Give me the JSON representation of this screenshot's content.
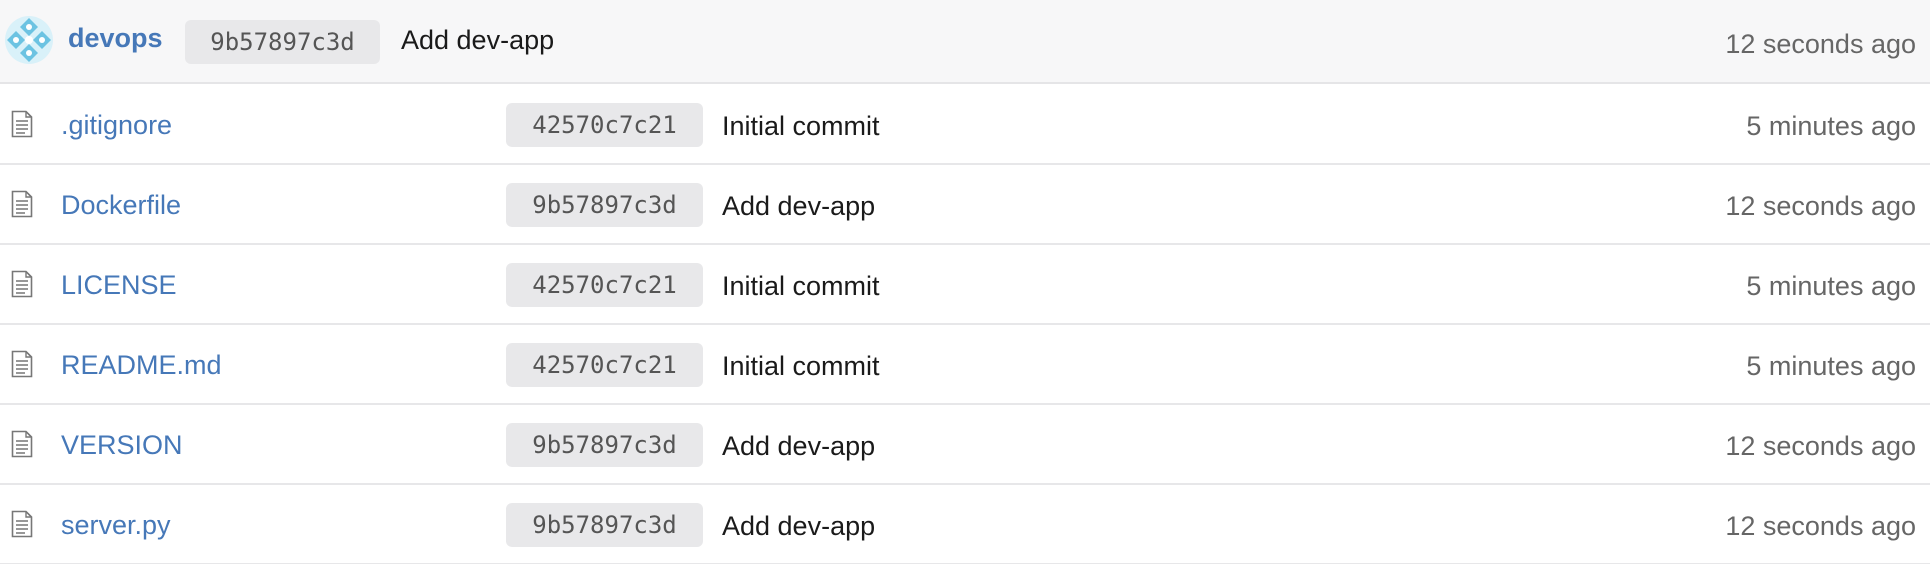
{
  "latest_commit": {
    "author": "devops",
    "sha": "9b57897c3d",
    "message": "Add dev-app",
    "time": "12 seconds ago",
    "avatar_color": "#6cc3e2"
  },
  "files": [
    {
      "icon": "file-icon",
      "name": ".gitignore",
      "sha": "42570c7c21",
      "message": "Initial commit",
      "time": "5 minutes ago"
    },
    {
      "icon": "file-icon",
      "name": "Dockerfile",
      "sha": "9b57897c3d",
      "message": "Add dev-app",
      "time": "12 seconds ago"
    },
    {
      "icon": "file-icon",
      "name": "LICENSE",
      "sha": "42570c7c21",
      "message": "Initial commit",
      "time": "5 minutes ago"
    },
    {
      "icon": "file-icon",
      "name": "README.md",
      "sha": "42570c7c21",
      "message": "Initial commit",
      "time": "5 minutes ago"
    },
    {
      "icon": "file-icon",
      "name": "VERSION",
      "sha": "9b57897c3d",
      "message": "Add dev-app",
      "time": "12 seconds ago"
    },
    {
      "icon": "file-icon",
      "name": "server.py",
      "sha": "9b57897c3d",
      "message": "Add dev-app",
      "time": "12 seconds ago"
    }
  ],
  "colors": {
    "link": "#4678b8",
    "sha_bg": "#e8e8ea",
    "header_bg": "#f7f7f8",
    "muted": "#666666"
  }
}
